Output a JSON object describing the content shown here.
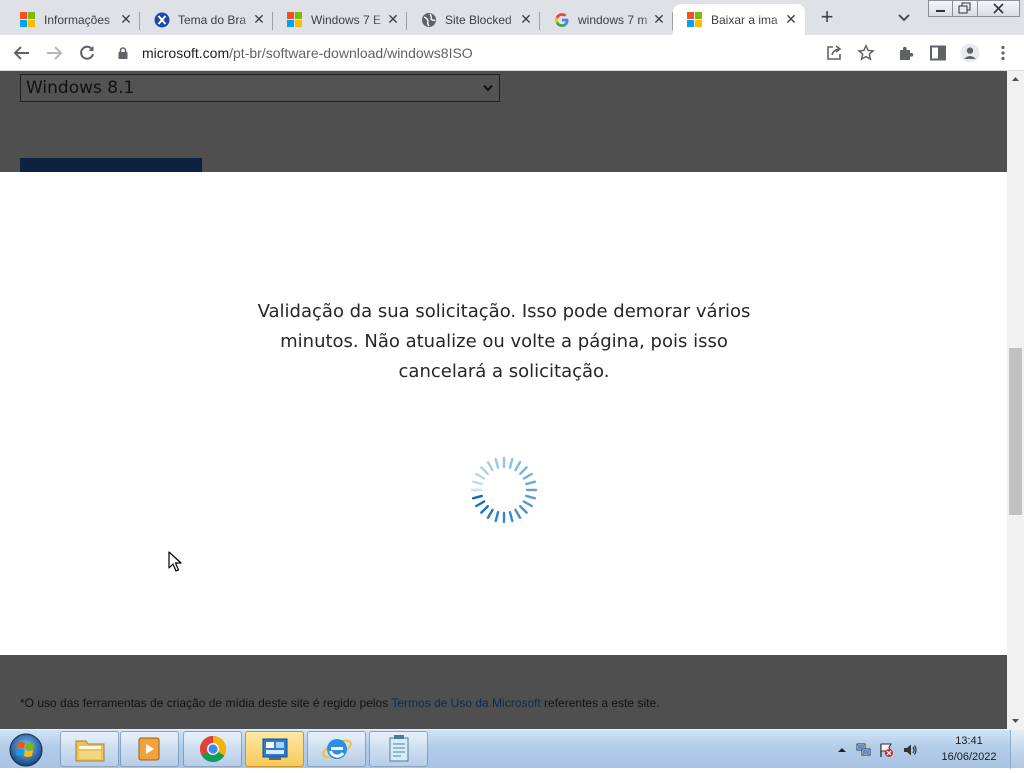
{
  "browser": {
    "tabs": [
      {
        "title": "Informações",
        "favicon": "microsoft-icon",
        "active": false
      },
      {
        "title": "Tema do Bra",
        "favicon": "x-icon",
        "active": false
      },
      {
        "title": "Windows 7 E",
        "favicon": "microsoft-icon",
        "active": false
      },
      {
        "title": "Site Blocked",
        "favicon": "globe-icon",
        "active": false
      },
      {
        "title": "windows 7 m",
        "favicon": "google-icon",
        "active": false
      },
      {
        "title": "Baixar a ima",
        "favicon": "microsoft-icon",
        "active": true
      }
    ],
    "new_tab_label": "+",
    "url": {
      "domain": "microsoft.com",
      "path": "/pt-br/software-download/windows8ISO"
    }
  },
  "page": {
    "edition_select": {
      "selected": "Windows 8.1"
    },
    "validation_message": "Validação da sua solicitação. Isso pode demorar vários minutos. Não atualize ou volte a página, pois isso cancelará a solicitação.",
    "footer": {
      "text_before": "*O uso das ferramentas de criação de mídia deste site é regido pelos ",
      "link": "Termos de Uso da Microsoft",
      "text_after": " referentes a este site."
    }
  },
  "taskbar": {
    "apps": [
      "file-explorer-icon",
      "media-player-icon",
      "chrome-icon",
      "control-panel-icon",
      "internet-explorer-icon",
      "notepad-icon"
    ],
    "clock": {
      "time": "13:41",
      "date": "16/06/2022"
    }
  },
  "colors": {
    "overlay": "#4f4f4f",
    "spinner": "#0067b8",
    "link": "#0d2a52"
  }
}
